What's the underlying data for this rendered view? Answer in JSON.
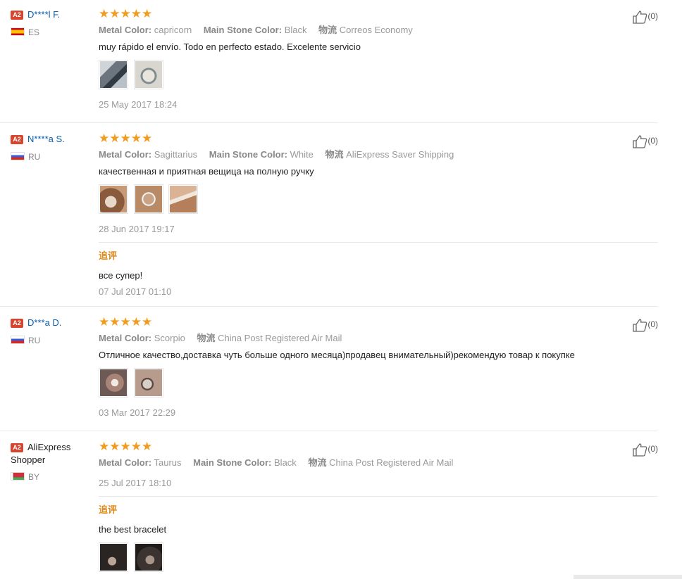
{
  "reviews": [
    {
      "badge": "A2",
      "name": "D****l F.",
      "country": "ES",
      "props": [
        {
          "key": "Metal Color:",
          "value": "capricorn"
        },
        {
          "key": "Main Stone Color:",
          "value": "Black"
        },
        {
          "key": "物流",
          "value": "Correos Economy"
        }
      ],
      "text": "muy rápido el envío. Todo en perfecto estado. Excelente servicio",
      "date": "25 May 2017 18:24",
      "likes": "(0)"
    },
    {
      "badge": "A2",
      "name": "N****a S.",
      "country": "RU",
      "props": [
        {
          "key": "Metal Color:",
          "value": "Sagittarius"
        },
        {
          "key": "Main Stone Color:",
          "value": "White"
        },
        {
          "key": "物流",
          "value": "AliExpress Saver Shipping"
        }
      ],
      "text": "качественная и приятная вещица на полную ручку",
      "date": "28 Jun 2017 19:17",
      "followup_title": "追评",
      "followup_text": "все супер!",
      "followup_date": "07 Jul 2017 01:10",
      "likes": "(0)"
    },
    {
      "badge": "A2",
      "name": "D***a D.",
      "country": "RU",
      "props": [
        {
          "key": "Metal Color:",
          "value": "Scorpio"
        },
        {
          "key": "物流",
          "value": "China Post Registered Air Mail"
        }
      ],
      "text": "Отличное качество,доставка чуть больше одного месяца)продавец внимательный)рекомендую товар к покупке",
      "date": "03 Mar 2017 22:29",
      "likes": "(0)"
    },
    {
      "badge": "A2",
      "name_line1": "AliExpress",
      "name_line2": "Shopper",
      "country": "BY",
      "props": [
        {
          "key": "Metal Color:",
          "value": "Taurus"
        },
        {
          "key": "Main Stone Color:",
          "value": "Black"
        },
        {
          "key": "物流",
          "value": "China Post Registered Air Mail"
        }
      ],
      "date": "25 Jul 2017 18:10",
      "followup_title": "追评",
      "followup_text": "the best bracelet",
      "likes": "(0)"
    }
  ],
  "stars": "★★★★★",
  "colors": {
    "accent": "#f29c1f",
    "link": "#0a5ea8",
    "badge": "#d9442e"
  },
  "icons": {
    "like": "thumbs-up-icon"
  }
}
